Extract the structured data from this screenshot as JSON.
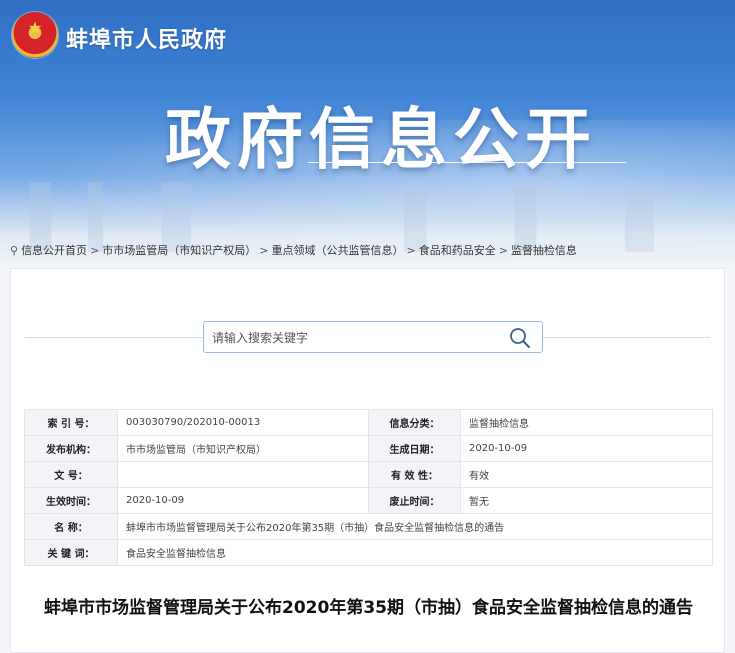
{
  "header": {
    "site_name": "蚌埠市人民政府",
    "banner_title": "政府信息公开",
    "emblem_icon": "national-emblem-icon"
  },
  "breadcrumb": {
    "icon": "location-pin-icon",
    "items": [
      "信息公开首页",
      "市市场监管局（市知识产权局）",
      "重点领域（公共监管信息）",
      "食品和药品安全",
      "监督抽检信息"
    ],
    "separator": ">"
  },
  "search": {
    "placeholder": "请输入搜索关键字",
    "value": "",
    "icon": "search-icon"
  },
  "meta": {
    "index_label": "索 引 号：",
    "index_value": "003030790/202010-00013",
    "category_label": "信息分类：",
    "category_value": "监督抽检信息",
    "publisher_label": "发布机构：",
    "publisher_value": "市市场监管局（市知识产权局）",
    "created_label": "生成日期：",
    "created_value": "2020-10-09",
    "docno_label": "文 号：",
    "docno_value": "",
    "validity_label": "有 效 性：",
    "validity_value": "有效",
    "effective_label": "生效时间：",
    "effective_value": "2020-10-09",
    "abolish_label": "废止时间：",
    "abolish_value": "暂无",
    "name_label": "名 称：",
    "name_value": "蚌埠市市场监督管理局关于公布2020年第35期（市抽）食品安全监督抽检信息的通告",
    "keywords_label": "关 键 词：",
    "keywords_value": "食品安全监督抽检信息"
  },
  "document": {
    "title": "蚌埠市市场监督管理局关于公布2020年第35期（市抽）食品安全监督抽检信息的通告"
  },
  "colors": {
    "banner_blue": "#3f82d6",
    "table_key_bg": "#f2f4f7",
    "search_border": "#9dbbe0"
  }
}
